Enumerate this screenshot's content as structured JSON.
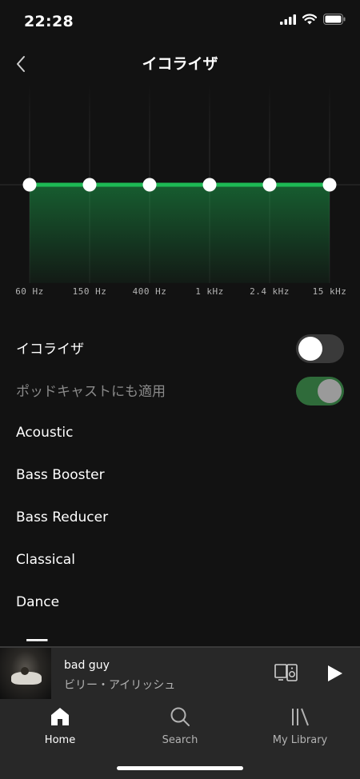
{
  "status_bar": {
    "time": "22:28"
  },
  "header": {
    "title": "イコライザ"
  },
  "equalizer": {
    "bands": [
      {
        "label": "60 Hz",
        "gain": 0
      },
      {
        "label": "150 Hz",
        "gain": 0
      },
      {
        "label": "400 Hz",
        "gain": 0
      },
      {
        "label": "1 kHz",
        "gain": 0
      },
      {
        "label": "2.4 kHz",
        "gain": 0
      },
      {
        "label": "15 kHz",
        "gain": 0
      }
    ],
    "accent_color": "#1db954"
  },
  "settings": {
    "equalizer_toggle": {
      "label": "イコライザ",
      "on": false
    },
    "podcast_toggle": {
      "label": "ポッドキャストにも適用",
      "on": true,
      "enabled": false
    }
  },
  "presets": [
    "Acoustic",
    "Bass Booster",
    "Bass Reducer",
    "Classical",
    "Dance"
  ],
  "now_playing": {
    "title": "bad guy",
    "artist": "ビリー・アイリッシュ"
  },
  "tabs": [
    {
      "label": "Home",
      "icon": "home-icon",
      "active": true
    },
    {
      "label": "Search",
      "icon": "search-icon",
      "active": false
    },
    {
      "label": "My Library",
      "icon": "library-icon",
      "active": false
    }
  ]
}
